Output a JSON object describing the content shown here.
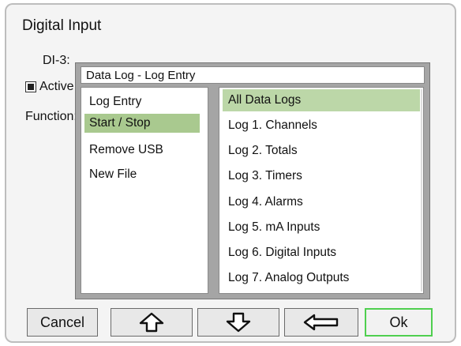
{
  "screen": {
    "title": "Digital Input",
    "di_label": "DI-3:",
    "active_label": "Active",
    "function_label": "Function:"
  },
  "dialog": {
    "title": "Data Log - Log Entry",
    "left_items": [
      {
        "label": "Log Entry",
        "selected": false
      },
      {
        "label": "Start / Stop",
        "selected": true
      },
      {
        "label": "Remove USB",
        "selected": false
      },
      {
        "label": "New File",
        "selected": false
      }
    ],
    "right_items": [
      {
        "label": "All Data Logs",
        "selected": true
      },
      {
        "label": "Log 1. Channels",
        "selected": false
      },
      {
        "label": "Log 2. Totals",
        "selected": false
      },
      {
        "label": "Log 3. Timers",
        "selected": false
      },
      {
        "label": "Log 4. Alarms",
        "selected": false
      },
      {
        "label": "Log 5. mA Inputs",
        "selected": false
      },
      {
        "label": "Log 6. Digital Inputs",
        "selected": false
      },
      {
        "label": "Log 7. Analog Outputs",
        "selected": false
      }
    ]
  },
  "buttons": {
    "cancel": "Cancel",
    "up_icon": "arrow-up-icon",
    "down_icon": "arrow-down-icon",
    "back_icon": "arrow-left-icon",
    "ok": "Ok"
  },
  "colors": {
    "selection_left": "#a9c98f",
    "selection_right": "#bcd7a8",
    "ok_border": "#4fcf4f",
    "dialog_bg": "#a5a5a5"
  }
}
